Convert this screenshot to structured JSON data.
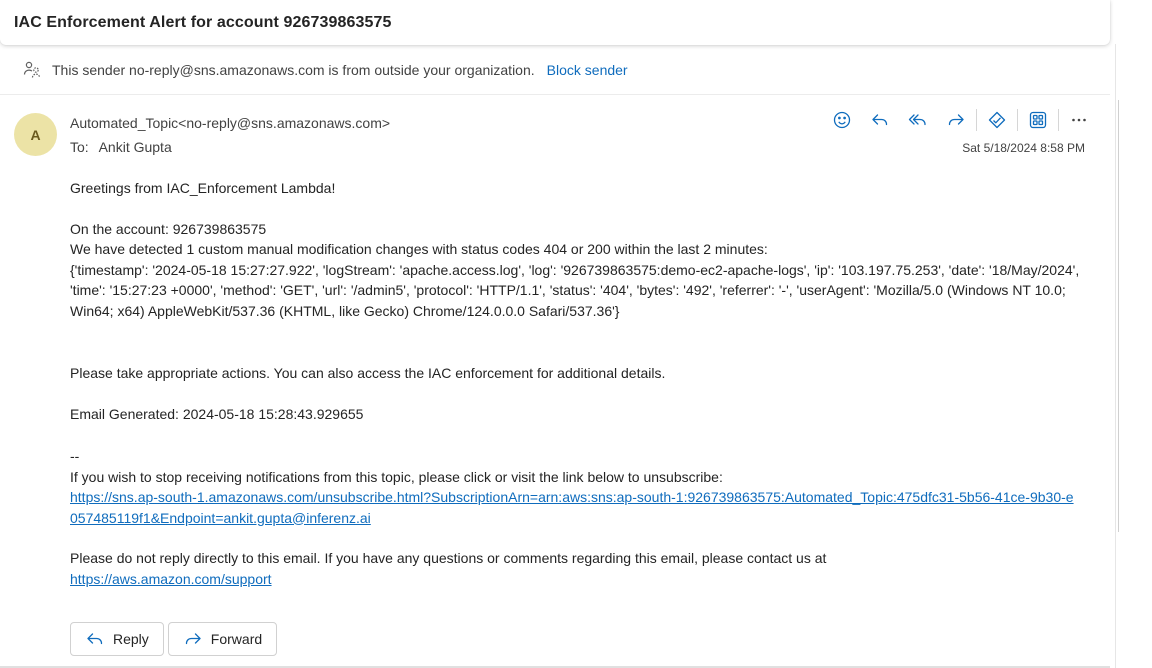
{
  "subject": "IAC Enforcement Alert for account 926739863575",
  "warning": {
    "text": "This sender no-reply@sns.amazonaws.com is from outside your organization.",
    "block_label": "Block sender"
  },
  "message": {
    "avatar_initial": "A",
    "avatar_color": "#ece3a6",
    "from": "Automated_Topic<no-reply@sns.amazonaws.com>",
    "to_label": "To:",
    "to_name": "Ankit Gupta",
    "date": "Sat 5/18/2024 8:58 PM",
    "toolbar_icons": [
      "emoji-icon",
      "reply-icon",
      "reply-all-icon",
      "forward-icon",
      "immersive-reader-icon",
      "apps-icon",
      "more-icon"
    ]
  },
  "body": {
    "greeting": "Greetings from IAC_Enforcement Lambda!",
    "account_line": "On the account: 926739863575",
    "detected_line": "We have detected 1 custom manual modification changes with status codes 404 or 200 within the last 2 minutes:",
    "log_record": "{'timestamp': '2024-05-18 15:27:27.922', 'logStream': 'apache.access.log', 'log': '926739863575:demo-ec2-apache-logs', 'ip': '103.197.75.253', 'date': '18/May/2024', 'time': '15:27:23 +0000', 'method': 'GET', 'url': '/admin5', 'protocol': 'HTTP/1.1', 'status': '404', 'bytes': '492', 'referrer': '-', 'userAgent': 'Mozilla/5.0 (Windows NT 10.0; Win64; x64) AppleWebKit/537.36 (KHTML, like Gecko) Chrome/124.0.0.0 Safari/537.36'}",
    "action_line": "Please take appropriate actions. You can also access the IAC enforcement for additional details.",
    "generated_line": "Email Generated: 2024-05-18 15:28:43.929655",
    "separator": "--",
    "unsubscribe_intro": "If you wish to stop receiving notifications from this topic, please click or visit the link below to unsubscribe:",
    "unsubscribe_link": "https://sns.ap-south-1.amazonaws.com/unsubscribe.html?SubscriptionArn=arn:aws:sns:ap-south-1:926739863575:Automated_Topic:475dfc31-5b56-41ce-9b30-e057485119f1&Endpoint=ankit.gupta@inferenz.ai",
    "no_reply_line": "Please do not reply directly to this email. If you have any questions or comments regarding this email, please contact us at",
    "support_link": "https://aws.amazon.com/support"
  },
  "actions": {
    "reply_label": "Reply",
    "forward_label": "Forward"
  },
  "colors": {
    "accent": "#0f6cbd",
    "text": "#242424"
  }
}
